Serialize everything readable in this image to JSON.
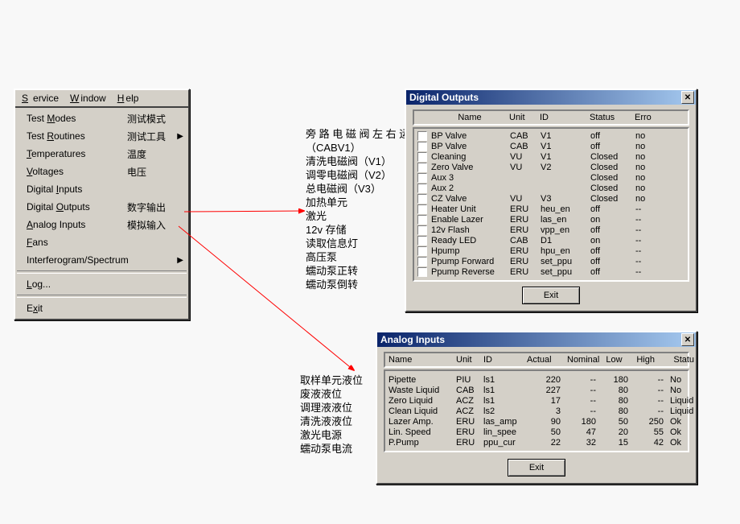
{
  "menu_bar": {
    "service": "Service",
    "window": "Window",
    "help": "Help"
  },
  "menu_items": [
    {
      "en": "Test Modes",
      "cn": "测试模式",
      "arrow": false
    },
    {
      "en": "Test Routines",
      "cn": "测试工具",
      "arrow": true
    },
    {
      "en": "Temperatures",
      "cn": "温度",
      "arrow": false
    },
    {
      "en": "Voltages",
      "cn": "电压",
      "arrow": false
    },
    {
      "en": "Digital Inputs",
      "cn": "",
      "arrow": false
    },
    {
      "en": "Digital Outputs",
      "cn": "数字输出",
      "arrow": false
    },
    {
      "en": "Analog Inputs",
      "cn": "模拟输入",
      "arrow": false
    },
    {
      "en": "Fans",
      "cn": "",
      "arrow": false
    },
    {
      "en": "Interferogram/Spectrum",
      "cn": "",
      "arrow": true
    }
  ],
  "menu_log": "Log...",
  "menu_exit": "Exit",
  "labels_a": [
    "旁 路 电 磁 阀 左 右 运 动",
    "（CABV1）",
    "清洗电磁阀（V1）",
    "调零电磁阀（V2）",
    "总电磁阀（V3）",
    "加热单元",
    "激光",
    "12v 存储",
    "读取信息灯",
    "高压泵",
    "蠕动泵正转",
    "蠕动泵倒转"
  ],
  "labels_b": [
    "取样单元液位",
    "废液液位",
    "调理液液位",
    "清洗液液位",
    "激光电源",
    "蠕动泵电流"
  ],
  "do": {
    "title": "Digital Outputs",
    "head": {
      "name": "Name",
      "unit": "Unit",
      "id": "ID",
      "status": "Status",
      "error": "Erro"
    },
    "rows": [
      {
        "name": "BP Valve",
        "unit": "CAB",
        "id": "V1",
        "status": "off",
        "err": "no"
      },
      {
        "name": "BP Valve",
        "unit": "CAB",
        "id": "V1",
        "status": "off",
        "err": "no"
      },
      {
        "name": "Cleaning",
        "unit": "VU",
        "id": "V1",
        "status": "Closed",
        "err": "no"
      },
      {
        "name": "Zero Valve",
        "unit": "VU",
        "id": "V2",
        "status": "Closed",
        "err": "no"
      },
      {
        "name": "Aux 3",
        "unit": "",
        "id": "",
        "status": "Closed",
        "err": "no"
      },
      {
        "name": "Aux 2",
        "unit": "",
        "id": "",
        "status": "Closed",
        "err": "no"
      },
      {
        "name": "CZ Valve",
        "unit": "VU",
        "id": "V3",
        "status": "Closed",
        "err": "no"
      },
      {
        "name": "Heater Unit",
        "unit": "ERU",
        "id": "heu_en",
        "status": "off",
        "err": "--"
      },
      {
        "name": "Enable Lazer",
        "unit": "ERU",
        "id": "las_en",
        "status": "on",
        "err": "--"
      },
      {
        "name": "12v Flash",
        "unit": "ERU",
        "id": "vpp_en",
        "status": "off",
        "err": "--"
      },
      {
        "name": "Ready LED",
        "unit": "CAB",
        "id": "D1",
        "status": "on",
        "err": "--"
      },
      {
        "name": "Hpump",
        "unit": "ERU",
        "id": "hpu_en",
        "status": "off",
        "err": "--"
      },
      {
        "name": "Ppump Forward",
        "unit": "ERU",
        "id": "set_ppu",
        "status": "off",
        "err": "--"
      },
      {
        "name": "Ppump Reverse",
        "unit": "ERU",
        "id": "set_ppu",
        "status": "off",
        "err": "--"
      }
    ],
    "exit": "Exit"
  },
  "ai": {
    "title": "Analog Inputs",
    "head": {
      "name": "Name",
      "unit": "Unit",
      "id": "ID",
      "actual": "Actual",
      "nominal": "Nominal",
      "low": "Low",
      "high": "High",
      "status": "Statu"
    },
    "rows": [
      {
        "name": "Pipette",
        "unit": "PIU",
        "id": "ls1",
        "actual": "220",
        "nominal": "--",
        "low": "180",
        "high": "--",
        "status": "No"
      },
      {
        "name": "Waste Liquid",
        "unit": "CAB",
        "id": "ls1",
        "actual": "227",
        "nominal": "--",
        "low": "80",
        "high": "--",
        "status": "No"
      },
      {
        "name": "Zero Liquid",
        "unit": "ACZ",
        "id": "ls1",
        "actual": "17",
        "nominal": "--",
        "low": "80",
        "high": "--",
        "status": "Liquid"
      },
      {
        "name": "Clean Liquid",
        "unit": "ACZ",
        "id": "ls2",
        "actual": "3",
        "nominal": "--",
        "low": "80",
        "high": "--",
        "status": "Liquid"
      },
      {
        "name": "Lazer Amp.",
        "unit": "ERU",
        "id": "las_amp",
        "actual": "90",
        "nominal": "180",
        "low": "50",
        "high": "250",
        "status": "Ok"
      },
      {
        "name": "Lin. Speed",
        "unit": "ERU",
        "id": "lin_spee",
        "actual": "50",
        "nominal": "47",
        "low": "20",
        "high": "55",
        "status": "Ok"
      },
      {
        "name": "P.Pump",
        "unit": "ERU",
        "id": "ppu_cur",
        "actual": "22",
        "nominal": "32",
        "low": "15",
        "high": "42",
        "status": "Ok"
      }
    ],
    "exit": "Exit"
  }
}
